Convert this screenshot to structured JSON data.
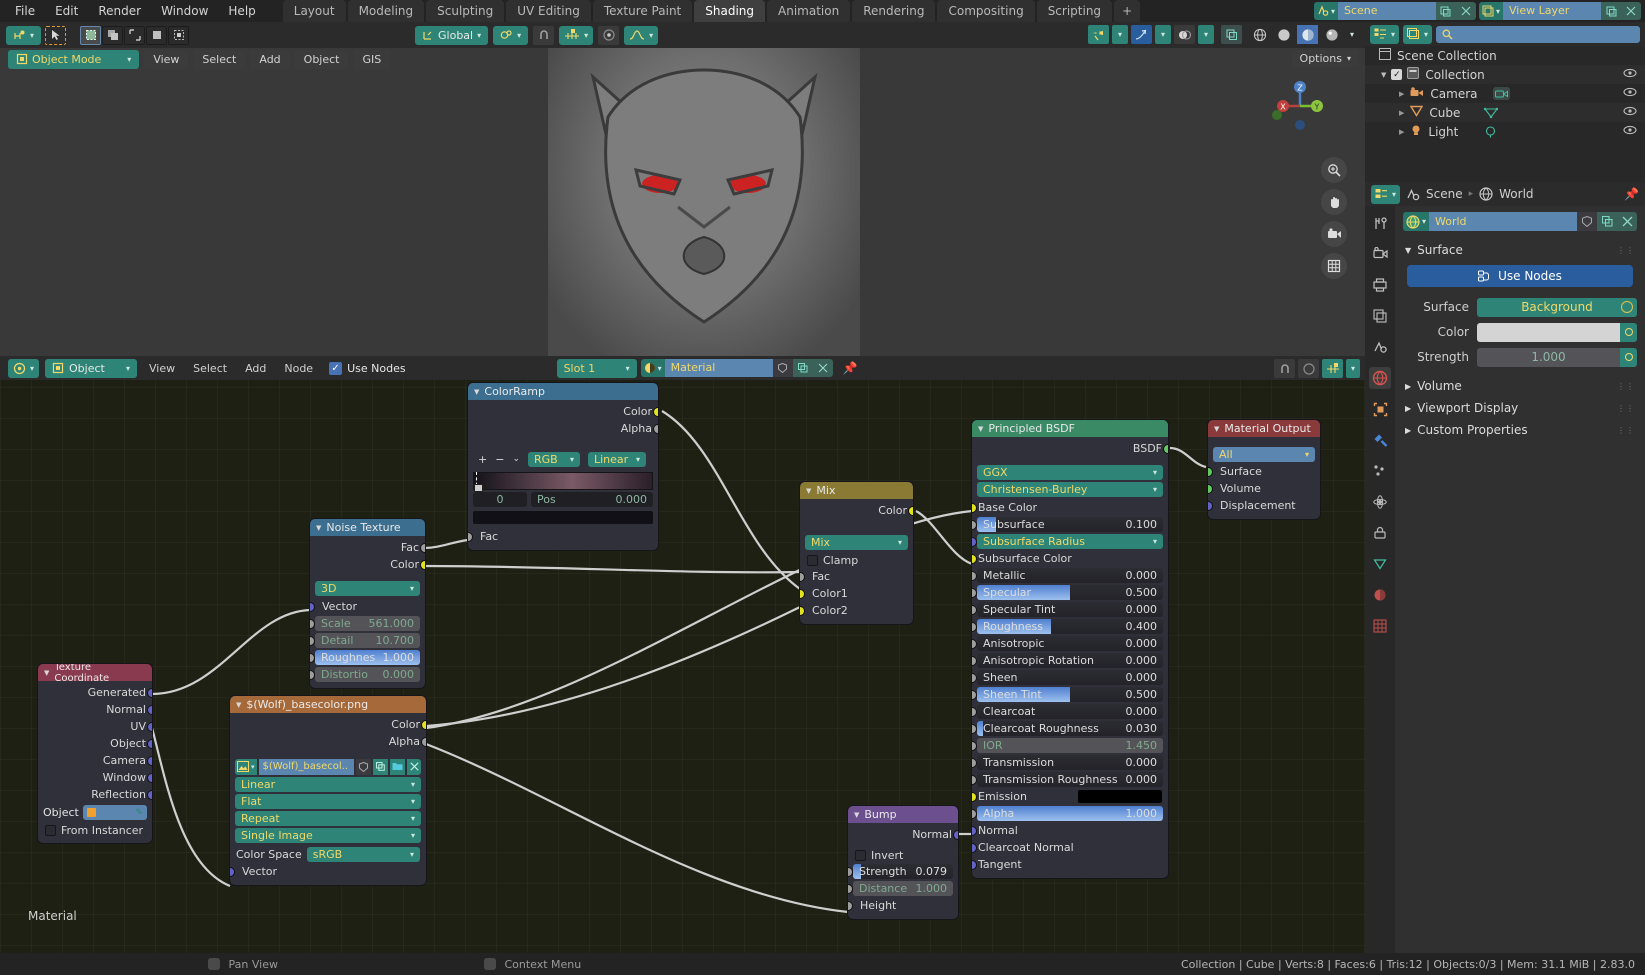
{
  "topbar": {
    "menus": [
      "File",
      "Edit",
      "Render",
      "Window",
      "Help"
    ],
    "workspace_tabs": [
      {
        "label": "Layout",
        "active": false
      },
      {
        "label": "Modeling",
        "active": false
      },
      {
        "label": "Sculpting",
        "active": false
      },
      {
        "label": "UV Editing",
        "active": false
      },
      {
        "label": "Texture Paint",
        "active": false
      },
      {
        "label": "Shading",
        "active": true
      },
      {
        "label": "Animation",
        "active": false
      },
      {
        "label": "Rendering",
        "active": false
      },
      {
        "label": "Compositing",
        "active": false
      },
      {
        "label": "Scripting",
        "active": false
      },
      {
        "label": "+",
        "active": false
      }
    ],
    "scene_field": "Scene",
    "viewlayer_field": "View Layer",
    "scene_icon": "scene-icon",
    "viewlayer_icon": "view-layer-icon"
  },
  "viewport": {
    "editor_type_icon": "editor-type-icon",
    "mode": "Object Mode",
    "menus": [
      "View",
      "Select",
      "Add",
      "Object",
      "GIS"
    ],
    "transform_orientation": "Global",
    "options_label": "Options",
    "select_modes": [
      "tweak",
      "box-select",
      "circle-select",
      "lasso-select",
      "select-box-alt"
    ],
    "cursor_tool_icon": "cursor-tool-icon",
    "snap_icon": "snap-magnet-icon",
    "proportional_icon": "proportional-edit-icon",
    "gizmo_axes": {
      "z": "Z",
      "y": "Y",
      "x": "X"
    },
    "overlay_icons": [
      "visibility-icon",
      "gizmo-icon",
      "overlays-icon",
      "xray-icon"
    ],
    "shading_modes": [
      "wireframe",
      "solid",
      "material-preview",
      "rendered"
    ],
    "nav_tools": [
      "zoom-icon",
      "pan-hand-icon",
      "camera-view-icon",
      "toggle-ortho-icon"
    ]
  },
  "shader_editor": {
    "editor_icon": "shader-editor-icon",
    "shader_type": "Object",
    "menus": [
      "View",
      "Select",
      "Add",
      "Node"
    ],
    "use_nodes_label": "Use Nodes",
    "use_nodes_checked": true,
    "slot": "Slot 1",
    "material_name": "Material",
    "material_icon": "material-icon",
    "bottom_label": "Material",
    "right_icons": [
      "snap-icon",
      "proportional-icon",
      "overlay-icon"
    ]
  },
  "nodes": {
    "colorramp": {
      "title": "ColorRamp",
      "outputs": [
        "Color",
        "Alpha"
      ],
      "buttons": [
        "+",
        "−",
        "⌄"
      ],
      "color_mode": "RGB",
      "interpolation": "Linear",
      "index": "0",
      "pos_label": "Pos",
      "pos_value": "0.000",
      "inputs": [
        "Fac"
      ]
    },
    "noise_texture": {
      "title": "Noise Texture",
      "outputs": [
        "Fac",
        "Color"
      ],
      "dimension": "3D",
      "inputs": [
        "Vector"
      ],
      "fields": [
        {
          "label": "Scale",
          "value": "561.000",
          "dim": true
        },
        {
          "label": "Detail",
          "value": "10.700",
          "dim": true
        },
        {
          "label": "Roughnes",
          "value": "1.000",
          "dim": false
        },
        {
          "label": "Distortio",
          "value": "0.000",
          "dim": true
        }
      ]
    },
    "texture_coordinate": {
      "title": "Texture Coordinate",
      "outputs": [
        "Generated",
        "Normal",
        "UV",
        "Object",
        "Camera",
        "Window",
        "Reflection"
      ],
      "object_label": "Object",
      "object_value": "",
      "from_instancer_label": "From Instancer"
    },
    "image_texture": {
      "title": "$(Wolf)_basecolor.png",
      "outputs": [
        "Color",
        "Alpha"
      ],
      "image_name": "$(Wolf)_basecol..",
      "interpolation": "Linear",
      "projection": "Flat",
      "extension": "Repeat",
      "source": "Single Image",
      "color_space_label": "Color Space",
      "color_space": "sRGB",
      "inputs": [
        "Vector"
      ]
    },
    "mix": {
      "title": "Mix",
      "outputs": [
        "Color"
      ],
      "blend_type": "Mix",
      "clamp_label": "Clamp",
      "inputs": [
        "Fac",
        "Color1",
        "Color2"
      ]
    },
    "bump": {
      "title": "Bump",
      "outputs": [
        "Normal"
      ],
      "invert_label": "Invert",
      "fields": [
        {
          "label": "Strength",
          "value": "0.079",
          "dim": false
        },
        {
          "label": "Distance",
          "value": "1.000",
          "dim": true
        }
      ],
      "inputs": [
        "Height"
      ]
    },
    "principled": {
      "title": "Principled BSDF",
      "outputs": [
        "BSDF"
      ],
      "distribution": "GGX",
      "subsurface_method": "Christensen-Burley",
      "sockets": [
        {
          "label": "Base Color",
          "value": "",
          "kind": "color",
          "sock": "yellow"
        },
        {
          "label": "Subsurface",
          "value": "0.100",
          "kind": "slider",
          "fill": 10,
          "sock": "grey"
        },
        {
          "label": "Subsurface Radius",
          "value": "",
          "kind": "enum",
          "sock": "purple"
        },
        {
          "label": "Subsurface Color",
          "value": "",
          "kind": "color",
          "sock": "yellow"
        },
        {
          "label": "Metallic",
          "value": "0.000",
          "kind": "slider",
          "fill": 0,
          "sock": "grey"
        },
        {
          "label": "Specular",
          "value": "0.500",
          "kind": "slider",
          "fill": 50,
          "sock": "grey"
        },
        {
          "label": "Specular Tint",
          "value": "0.000",
          "kind": "slider",
          "fill": 0,
          "sock": "grey"
        },
        {
          "label": "Roughness",
          "value": "0.400",
          "kind": "slider",
          "fill": 40,
          "sock": "grey"
        },
        {
          "label": "Anisotropic",
          "value": "0.000",
          "kind": "slider",
          "fill": 0,
          "sock": "grey"
        },
        {
          "label": "Anisotropic Rotation",
          "value": "0.000",
          "kind": "slider",
          "fill": 0,
          "sock": "grey"
        },
        {
          "label": "Sheen",
          "value": "0.000",
          "kind": "slider",
          "fill": 0,
          "sock": "grey"
        },
        {
          "label": "Sheen Tint",
          "value": "0.500",
          "kind": "slider",
          "fill": 50,
          "sock": "grey"
        },
        {
          "label": "Clearcoat",
          "value": "0.000",
          "kind": "slider",
          "fill": 0,
          "sock": "grey"
        },
        {
          "label": "Clearcoat Roughness",
          "value": "0.030",
          "kind": "slider",
          "fill": 3,
          "sock": "grey"
        },
        {
          "label": "IOR",
          "value": "1.450",
          "kind": "dim",
          "fill": 0,
          "sock": "grey"
        },
        {
          "label": "Transmission",
          "value": "0.000",
          "kind": "slider",
          "fill": 0,
          "sock": "grey"
        },
        {
          "label": "Transmission Roughness",
          "value": "0.000",
          "kind": "slider",
          "fill": 0,
          "sock": "grey"
        },
        {
          "label": "Emission",
          "value": "",
          "kind": "black",
          "sock": "yellow"
        },
        {
          "label": "Alpha",
          "value": "1.000",
          "kind": "slider",
          "fill": 100,
          "sock": "grey"
        },
        {
          "label": "Normal",
          "value": "",
          "kind": "plain",
          "sock": "purple"
        },
        {
          "label": "Clearcoat Normal",
          "value": "",
          "kind": "plain",
          "sock": "purple"
        },
        {
          "label": "Tangent",
          "value": "",
          "kind": "plain",
          "sock": "purple"
        }
      ]
    },
    "material_output": {
      "title": "Material Output",
      "target": "All",
      "inputs": [
        "Surface",
        "Volume",
        "Displacement"
      ]
    }
  },
  "outliner": {
    "display_mode_icon": "outliner-display-icon",
    "filter_icon": "filter-icon",
    "search_placeholder": "",
    "rows": [
      {
        "label": "Scene Collection",
        "indent": 0,
        "icon": "collection-icon",
        "eye": false,
        "check": false,
        "disclosure": false
      },
      {
        "label": "Collection",
        "indent": 1,
        "icon": "collection-icon",
        "eye": true,
        "check": true,
        "disclosure": true
      },
      {
        "label": "Camera",
        "indent": 2,
        "icon": "camera-icon",
        "eye": true,
        "check": false,
        "disclosure": true
      },
      {
        "label": "Cube",
        "indent": 2,
        "icon": "mesh-icon",
        "eye": true,
        "check": false,
        "disclosure": true
      },
      {
        "label": "Light",
        "indent": 2,
        "icon": "light-icon",
        "eye": true,
        "check": false,
        "disclosure": true
      }
    ]
  },
  "properties": {
    "breadcrumb": [
      "Scene",
      "World"
    ],
    "world_name": "World",
    "tabs": [
      "tool-icon",
      "render-icon",
      "output-icon",
      "view-layer-icon",
      "scene-icon",
      "world-icon",
      "object-icon",
      "modifier-icon",
      "particles-icon",
      "physics-icon",
      "constraints-icon",
      "data-icon",
      "material-icon",
      "texture-icon"
    ],
    "active_tab_index": 5,
    "sections": [
      {
        "label": "Surface",
        "open": true
      },
      {
        "label": "Volume",
        "open": false
      },
      {
        "label": "Viewport Display",
        "open": false
      },
      {
        "label": "Custom Properties",
        "open": false
      }
    ],
    "use_nodes_button": "Use Nodes",
    "surface_label": "Surface",
    "surface_value": "Background",
    "color_label": "Color",
    "strength_label": "Strength",
    "strength_value": "1.000"
  },
  "statusbar": {
    "hints": [
      {
        "icon": "mouse-middle-icon",
        "label": "Pan View"
      },
      {
        "icon": "mouse-right-icon",
        "label": "Context Menu"
      }
    ],
    "stats": "Collection | Cube | Verts:8 | Faces:6 | Tris:12 | Objects:0/3 | Mem: 31.1 MiB | 2.83.0"
  },
  "colors": {
    "accent_teal": "#2e8577",
    "accent_blue": "#4772b3",
    "node_header_teal": "#3b6e8f",
    "node_header_green": "#3a7d56",
    "node_header_orange": "#a15f33",
    "node_header_purple": "#6c4f8f",
    "node_header_red": "#8a3a3a",
    "yellow_text": "#f0d86a"
  }
}
